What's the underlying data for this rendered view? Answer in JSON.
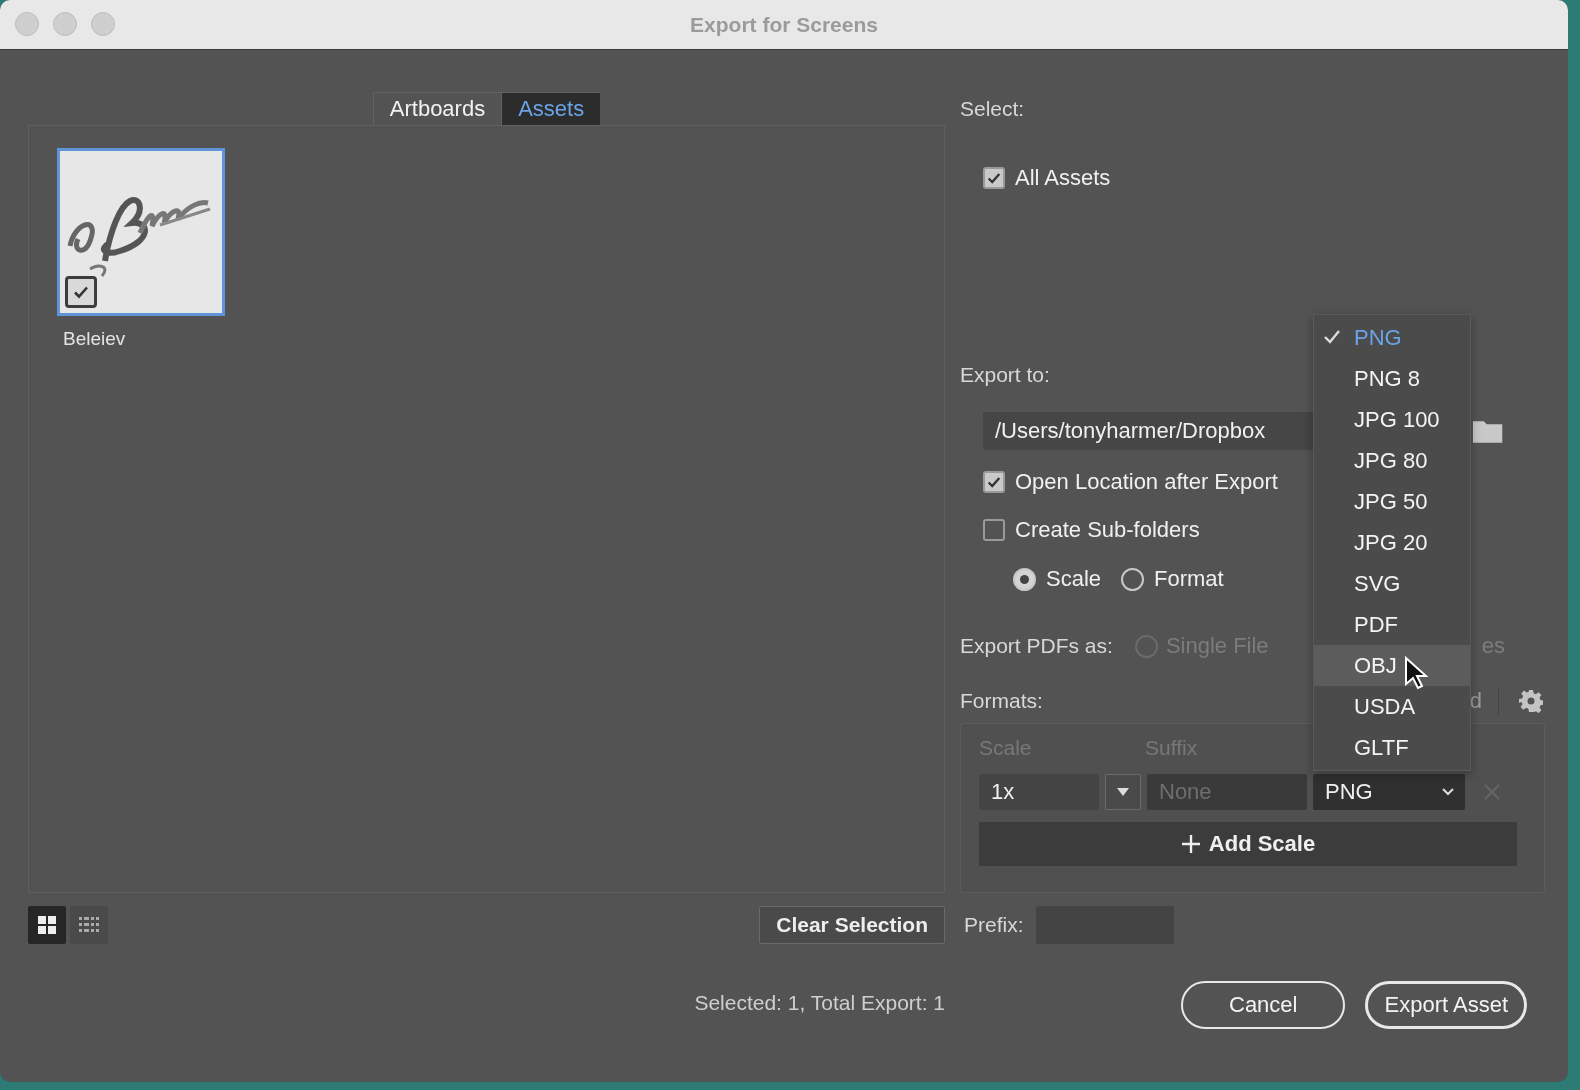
{
  "window": {
    "title": "Export for Screens"
  },
  "tabs": [
    {
      "label": "Artboards",
      "selected": false
    },
    {
      "label": "Assets",
      "selected": true
    }
  ],
  "assets": [
    {
      "name": "Beleiev",
      "checked": true,
      "selected": true,
      "kind": "picture"
    }
  ],
  "view_toggle": [
    {
      "kind": "grid",
      "selected": true
    },
    {
      "kind": "list",
      "selected": false
    }
  ],
  "clear_selection": "Clear Selection",
  "summary": "Selected: 1, Total Export: 1",
  "select": {
    "label": "Select:",
    "options": [
      {
        "label": "All Assets",
        "checked": true
      }
    ]
  },
  "export_to": {
    "label": "Export to:",
    "path": "/Users/tonyharmer/Dropbox",
    "options": [
      {
        "label": "Open Location after Export",
        "checked": true
      },
      {
        "label": "Create Sub-folders",
        "checked": false
      }
    ],
    "subfolder_by": [
      {
        "label": "Scale",
        "selected": true
      },
      {
        "label": "Format",
        "selected": false
      }
    ]
  },
  "export_pdfs": {
    "label": "Export PDFs as:",
    "disabled": true,
    "options": [
      {
        "label": "Single File",
        "selected": false
      }
    ],
    "covered_text": "es"
  },
  "formats": {
    "label": "Formats:",
    "covered_text": "d",
    "columns": [
      "Scale",
      "Suffix"
    ],
    "rows": [
      {
        "scale": "1x",
        "placeholder": "None",
        "format": "PNG"
      }
    ],
    "add_button": "Add Scale"
  },
  "format_menu": [
    {
      "label": "PNG",
      "selected": true,
      "hovered": false
    },
    {
      "label": "PNG 8",
      "selected": false,
      "hovered": false
    },
    {
      "label": "JPG 100",
      "selected": false,
      "hovered": false
    },
    {
      "label": "JPG 80",
      "selected": false,
      "hovered": false
    },
    {
      "label": "JPG 50",
      "selected": false,
      "hovered": false
    },
    {
      "label": "JPG 20",
      "selected": false,
      "hovered": false
    },
    {
      "label": "SVG",
      "selected": false,
      "hovered": false
    },
    {
      "label": "PDF",
      "selected": false,
      "hovered": false
    },
    {
      "label": "OBJ",
      "selected": false,
      "hovered": true
    },
    {
      "label": "USDA",
      "selected": false,
      "hovered": false
    },
    {
      "label": "GLTF",
      "selected": false,
      "hovered": false
    }
  ],
  "prefix": {
    "label": "Prefix:"
  },
  "buttons": [
    {
      "label": "Cancel",
      "kind": "secondary"
    },
    {
      "label": "Export Asset",
      "kind": "primary"
    }
  ]
}
